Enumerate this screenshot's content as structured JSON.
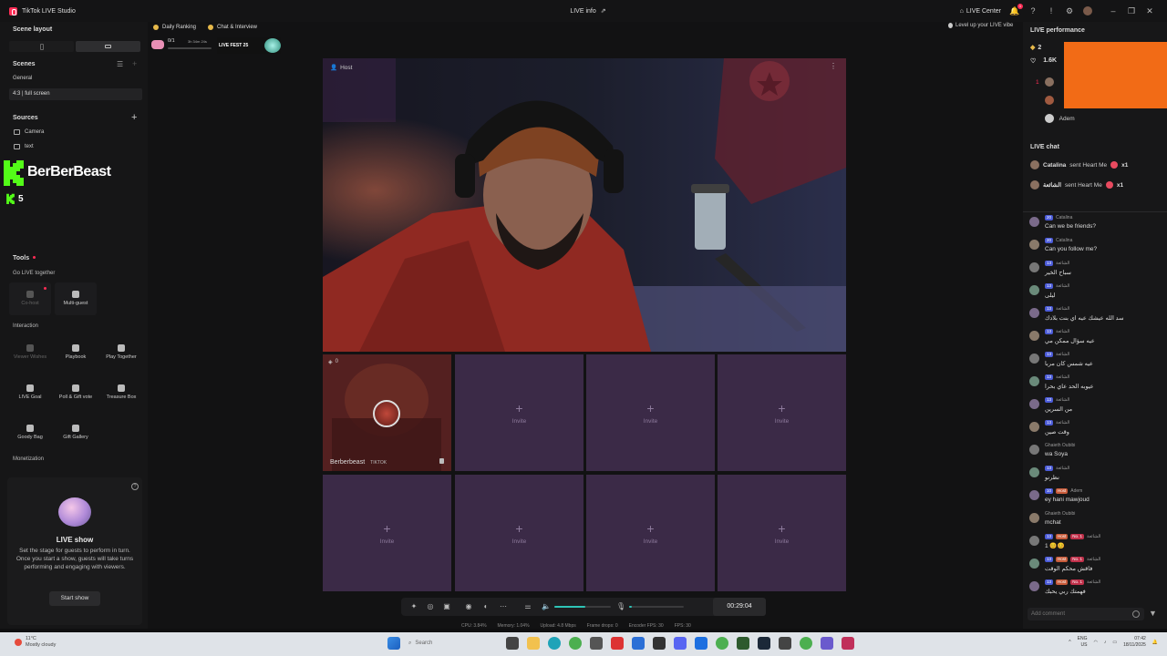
{
  "titlebar": {
    "app_name": "TikTok LIVE Studio",
    "center_title": "LIVE info",
    "live_center": "LIVE Center",
    "notif_count": "1"
  },
  "left": {
    "scene_layout": "Scene layout",
    "scenes": "Scenes",
    "scene_group": "General",
    "scene_item": "4:3 | full screen",
    "sources": "Sources",
    "source_items": [
      "Camera",
      "text"
    ],
    "overlay_name": "BerBerBeast",
    "overlay_count": "5",
    "tools": "Tools",
    "go_live_together": "Go LIVE together",
    "tools_group1": [
      {
        "label": "Co-host"
      },
      {
        "label": "Multi-guest"
      }
    ],
    "interaction": "Interaction",
    "tools_group2": [
      {
        "label": "Viewer Wishes"
      },
      {
        "label": "Playbook"
      },
      {
        "label": "Play Together"
      },
      {
        "label": "LIVE Goal"
      },
      {
        "label": "Poll & Gift vote"
      },
      {
        "label": "Treasure Box"
      },
      {
        "label": "Goody Bag"
      },
      {
        "label": "Gift Gallery"
      }
    ],
    "monetization": "Monetization",
    "live_show": {
      "title": "LIVE show",
      "desc": "Set the stage for guests to perform in turn. Once you start a show, guests will take turns performing and engaging with viewers.",
      "button": "Start show"
    }
  },
  "center": {
    "daily_ranking": "Daily Ranking",
    "chat_interview": "Chat & Interview",
    "ranking_value": "0/1",
    "ranking_time": "3h 34m 24s",
    "fest_label": "LIVE FEST 25",
    "host_tag": "Host",
    "guest_count": "0",
    "guest_name": "Berberbeast",
    "guest_sub": "TIKTOK",
    "invite": "Invite",
    "timer": "00:29:04",
    "stats": [
      "CPU: 3.84%",
      "Memory: 1.04%",
      "Upload: 4.8 Mbps",
      "Frame drops: 0",
      "Encoder FPS: 30",
      "FPS: 30"
    ],
    "volume_level": 0.55,
    "mic_level": 0.05
  },
  "right": {
    "live_performance": "LIVE performance",
    "diamonds": "2",
    "likes": "1.6K",
    "ranks": [
      {
        "rank": "1",
        "name": ""
      },
      {
        "rank": "2",
        "name": ""
      },
      {
        "rank": "3",
        "name": "Adem"
      }
    ],
    "live_chat": "LIVE chat",
    "gifts": [
      {
        "name": "Catalina",
        "text": "sent Heart Me",
        "count": "x1"
      },
      {
        "name": "الشائعة",
        "text": "sent Heart Me",
        "count": "x1"
      }
    ],
    "messages": [
      {
        "badges": [
          "20"
        ],
        "name": "Catalina",
        "text": "Can we be friends?"
      },
      {
        "badges": [
          "20"
        ],
        "name": "Catalina",
        "text": "Can you follow me?"
      },
      {
        "badges": [
          "13"
        ],
        "name": "الشائعة",
        "text": "سباح الخير"
      },
      {
        "badges": [
          "13"
        ],
        "name": "الشائعة",
        "text": "ليلى"
      },
      {
        "badges": [
          "13"
        ],
        "name": "الشائعة",
        "text": "سد الله عيشك عيه اي بنت بلادك"
      },
      {
        "badges": [
          "13"
        ],
        "name": "الشائعة",
        "text": "عيه سؤال ممكن مي"
      },
      {
        "badges": [
          "13"
        ],
        "name": "الشائعة",
        "text": "عيه شمس كان مربا"
      },
      {
        "badges": [
          "13"
        ],
        "name": "الشائعة",
        "text": "عيوبه الحد عاي بحرا"
      },
      {
        "badges": [
          "13"
        ],
        "name": "الشائعة",
        "text": "من السرين"
      },
      {
        "badges": [
          "13"
        ],
        "name": "الشائعة",
        "text": "وقت صين"
      },
      {
        "badges": [],
        "name": "Ghaieth Oubibi",
        "text": "wa Soya"
      },
      {
        "badges": [
          "13"
        ],
        "name": "الشائعة",
        "text": "نظرنو"
      },
      {
        "badges": [
          "10",
          "Host"
        ],
        "name": "Adem",
        "text": "ey hani mawjoud"
      },
      {
        "badges": [],
        "name": "Ghaieth Oubibi",
        "text": "mchat"
      },
      {
        "badges": [
          "13",
          "Host",
          "No. 1"
        ],
        "name": "الشائعة",
        "text": "1 😊😊"
      },
      {
        "badges": [
          "13",
          "Host",
          "No. 1"
        ],
        "name": "الشائعة",
        "text": "فاقش محكم الوقت"
      },
      {
        "badges": [
          "13",
          "Host",
          "No. 1"
        ],
        "name": "الشائعة",
        "text": "فهمتك ربي يحبك"
      }
    ],
    "add_comment": "Add comment",
    "level_up": "Level up your LIVE vibe"
  },
  "taskbar": {
    "weather_temp": "11°C",
    "weather_desc": "Mostly cloudy",
    "search": "Search",
    "lang": "ENG",
    "lang_sub": "US",
    "time": "07:42",
    "date": "18/11/2025"
  },
  "colors": {
    "accent": "#2ec4b6",
    "orange_block": "#f26b16",
    "invite_tile": "#3b2a47",
    "brand": "#fe2c55"
  }
}
